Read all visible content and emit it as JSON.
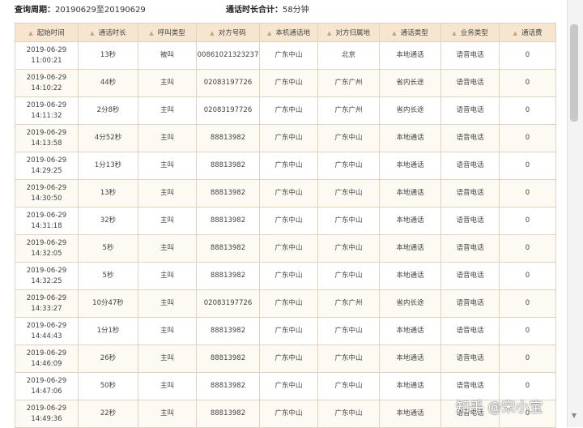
{
  "summary": {
    "period_label": "查询周期：",
    "period_value": "20190629至20190629",
    "total_label": "通话时长合计：",
    "total_value": "58分钟"
  },
  "table": {
    "headers": [
      "起始时间",
      "通话时长",
      "呼叫类型",
      "对方号码",
      "本机通话地",
      "对方归属地",
      "通话类型",
      "业务类型",
      "通话费"
    ],
    "rows": [
      {
        "date": "2019-06-29",
        "time": "11:00:21",
        "duration": "13秒",
        "call_type": "被叫",
        "number": "00861021323237",
        "local": "广东中山",
        "remote": "北京",
        "comm_type": "本地通话",
        "service": "语音电话",
        "fee": "0"
      },
      {
        "date": "2019-06-29",
        "time": "14:10:22",
        "duration": "44秒",
        "call_type": "主叫",
        "number": "02083197726",
        "local": "广东中山",
        "remote": "广东广州",
        "comm_type": "省内长途",
        "service": "语音电话",
        "fee": "0"
      },
      {
        "date": "2019-06-29",
        "time": "14:11:32",
        "duration": "2分8秒",
        "call_type": "主叫",
        "number": "02083197726",
        "local": "广东中山",
        "remote": "广东广州",
        "comm_type": "省内长途",
        "service": "语音电话",
        "fee": "0"
      },
      {
        "date": "2019-06-29",
        "time": "14:13:58",
        "duration": "4分52秒",
        "call_type": "主叫",
        "number": "88813982",
        "local": "广东中山",
        "remote": "广东中山",
        "comm_type": "本地通话",
        "service": "语音电话",
        "fee": "0"
      },
      {
        "date": "2019-06-29",
        "time": "14:29:25",
        "duration": "1分13秒",
        "call_type": "主叫",
        "number": "88813982",
        "local": "广东中山",
        "remote": "广东中山",
        "comm_type": "本地通话",
        "service": "语音电话",
        "fee": "0"
      },
      {
        "date": "2019-06-29",
        "time": "14:30:50",
        "duration": "13秒",
        "call_type": "主叫",
        "number": "88813982",
        "local": "广东中山",
        "remote": "广东中山",
        "comm_type": "本地通话",
        "service": "语音电话",
        "fee": "0"
      },
      {
        "date": "2019-06-29",
        "time": "14:31:18",
        "duration": "32秒",
        "call_type": "主叫",
        "number": "88813982",
        "local": "广东中山",
        "remote": "广东中山",
        "comm_type": "本地通话",
        "service": "语音电话",
        "fee": "0"
      },
      {
        "date": "2019-06-29",
        "time": "14:32:05",
        "duration": "5秒",
        "call_type": "主叫",
        "number": "88813982",
        "local": "广东中山",
        "remote": "广东中山",
        "comm_type": "本地通话",
        "service": "语音电话",
        "fee": "0"
      },
      {
        "date": "2019-06-29",
        "time": "14:32:25",
        "duration": "5秒",
        "call_type": "主叫",
        "number": "88813982",
        "local": "广东中山",
        "remote": "广东中山",
        "comm_type": "本地通话",
        "service": "语音电话",
        "fee": "0"
      },
      {
        "date": "2019-06-29",
        "time": "14:33:27",
        "duration": "10分47秒",
        "call_type": "主叫",
        "number": "02083197726",
        "local": "广东中山",
        "remote": "广东广州",
        "comm_type": "省内长途",
        "service": "语音电话",
        "fee": "0"
      },
      {
        "date": "2019-06-29",
        "time": "14:44:43",
        "duration": "1分1秒",
        "call_type": "主叫",
        "number": "88813982",
        "local": "广东中山",
        "remote": "广东中山",
        "comm_type": "本地通话",
        "service": "语音电话",
        "fee": "0"
      },
      {
        "date": "2019-06-29",
        "time": "14:46:09",
        "duration": "26秒",
        "call_type": "主叫",
        "number": "88813982",
        "local": "广东中山",
        "remote": "广东中山",
        "comm_type": "本地通话",
        "service": "语音电话",
        "fee": "0"
      },
      {
        "date": "2019-06-29",
        "time": "14:47:06",
        "duration": "50秒",
        "call_type": "主叫",
        "number": "88813982",
        "local": "广东中山",
        "remote": "广东中山",
        "comm_type": "本地通话",
        "service": "语音电话",
        "fee": "0"
      },
      {
        "date": "2019-06-29",
        "time": "14:49:36",
        "duration": "22秒",
        "call_type": "主叫",
        "number": "88813982",
        "local": "广东中山",
        "remote": "广东中山",
        "comm_type": "本地通话",
        "service": "语音电话",
        "fee": "0"
      }
    ]
  },
  "watermark": "知乎 @宋小宝",
  "icons": {
    "sort": "sort-arrow-icon",
    "scroll_down": "chevron-down-icon"
  },
  "colors": {
    "header_bg": "#f7e6cf",
    "border": "#e2d2bd",
    "row_alt": "#fdf9f3"
  }
}
